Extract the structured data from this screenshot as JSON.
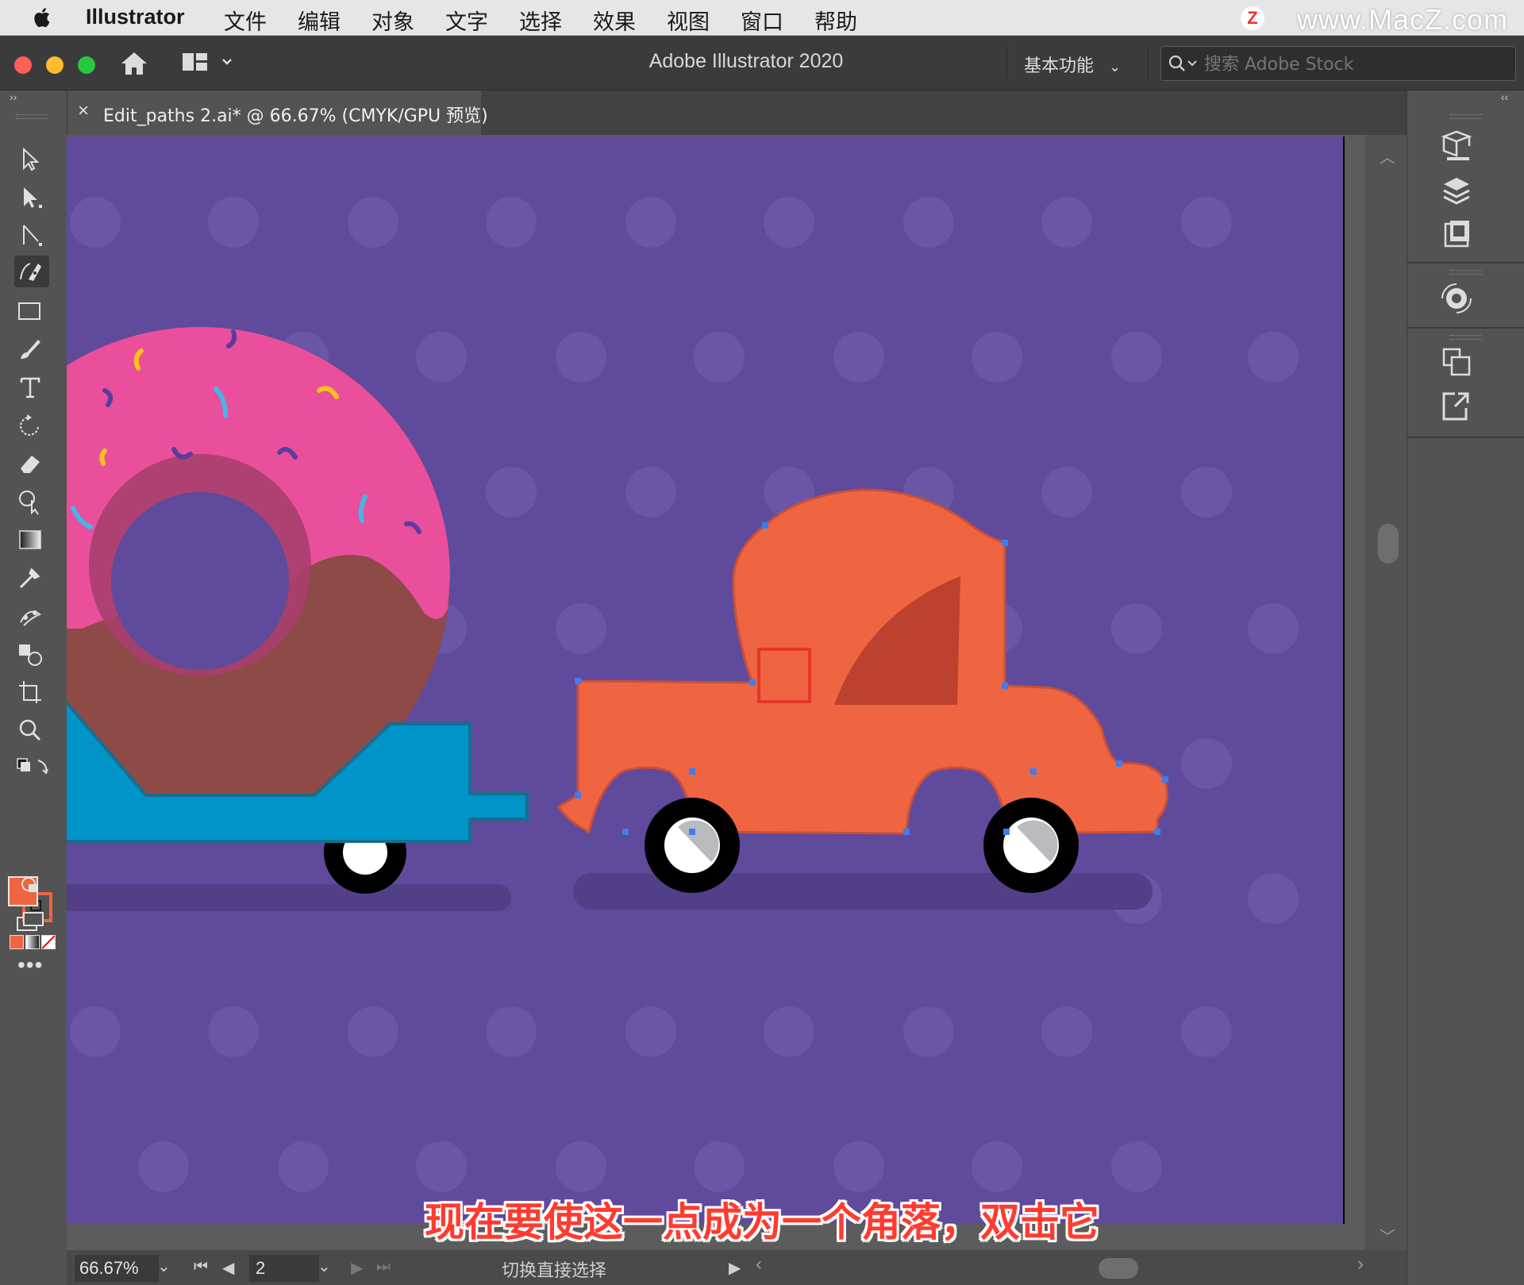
{
  "menubar": {
    "app_name": "Illustrator",
    "items": [
      "文件",
      "编辑",
      "对象",
      "文字",
      "选择",
      "效果",
      "视图",
      "窗口",
      "帮助"
    ],
    "watermark": "www.MacZ.com",
    "watermark_badge": "Z"
  },
  "titlebar": {
    "title": "Adobe Illustrator 2020",
    "workspace": "基本功能",
    "search_placeholder": "搜索 Adobe Stock"
  },
  "document_tab": {
    "label": "Edit_paths 2.ai* @ 66.67% (CMYK/GPU 预览)",
    "close_glyph": "×"
  },
  "statusbar": {
    "zoom": "66.67%",
    "page": "2",
    "status": "切换直接选择"
  },
  "caption": "现在要使这一点成为一个角落，双击它",
  "colors": {
    "artboard": "#5f4a9c",
    "truck": "#ef6542",
    "donut_icing": "#ea4f9c",
    "donut_body": "#8e4a47",
    "trailer": "#0094c8",
    "anchor_point": "#3f7cf0",
    "highlight": "#e4362b"
  },
  "toolbar": {
    "tools": [
      "selection-tool-icon",
      "direct-selection-tool-icon",
      "group-selection-tool-icon",
      "curvature-pen-tool-icon",
      "rectangle-tool-icon",
      "paintbrush-tool-icon",
      "type-tool-icon",
      "rotate-tool-icon",
      "eraser-tool-icon",
      "shape-builder-tool-icon",
      "gradient-tool-icon",
      "eyedropper-tool-icon",
      "puppet-warp-tool-icon",
      "blend-tool-icon",
      "artboard-tool-icon",
      "zoom-tool-icon"
    ]
  }
}
